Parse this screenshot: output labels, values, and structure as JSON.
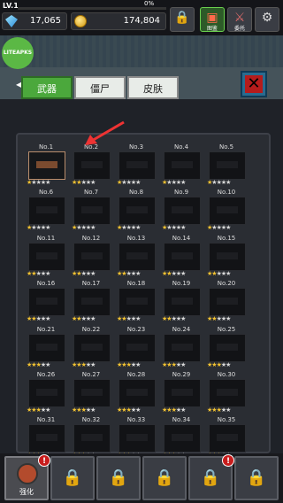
{
  "header": {
    "level": "LV.1",
    "xp_percent": "0%",
    "gems": "17,065",
    "coins": "174,804",
    "buttons": [
      {
        "name": "lock",
        "label": ""
      },
      {
        "name": "book",
        "label": "图鉴"
      },
      {
        "name": "commission",
        "label": "委托"
      },
      {
        "name": "settings",
        "label": ""
      }
    ]
  },
  "logo_text": "LITEAPKS",
  "tabs": [
    {
      "label": "武器",
      "active": true
    },
    {
      "label": "僵尸",
      "active": false
    },
    {
      "label": "皮肤",
      "active": false
    }
  ],
  "weapons": [
    {
      "label": "No.1",
      "stars": 1,
      "revealed": true,
      "selected": true
    },
    {
      "label": "No.2",
      "stars": 2
    },
    {
      "label": "No.3",
      "stars": 1
    },
    {
      "label": "No.4",
      "stars": 1
    },
    {
      "label": "No.5",
      "stars": 1
    },
    {
      "label": "No.6",
      "stars": 1
    },
    {
      "label": "No.7",
      "stars": 1
    },
    {
      "label": "No.8",
      "stars": 1
    },
    {
      "label": "No.9",
      "stars": 1
    },
    {
      "label": "No.10",
      "stars": 1
    },
    {
      "label": "No.11",
      "stars": 2
    },
    {
      "label": "No.12",
      "stars": 2
    },
    {
      "label": "No.13",
      "stars": 2
    },
    {
      "label": "No.14",
      "stars": 2
    },
    {
      "label": "No.15",
      "stars": 2
    },
    {
      "label": "No.16",
      "stars": 2
    },
    {
      "label": "No.17",
      "stars": 2
    },
    {
      "label": "No.18",
      "stars": 2
    },
    {
      "label": "No.19",
      "stars": 2
    },
    {
      "label": "No.20",
      "stars": 2
    },
    {
      "label": "No.21",
      "stars": 3
    },
    {
      "label": "No.22",
      "stars": 3
    },
    {
      "label": "No.23",
      "stars": 3
    },
    {
      "label": "No.24",
      "stars": 3
    },
    {
      "label": "No.25",
      "stars": 3
    },
    {
      "label": "No.26",
      "stars": 3
    },
    {
      "label": "No.27",
      "stars": 3
    },
    {
      "label": "No.28",
      "stars": 3
    },
    {
      "label": "No.29",
      "stars": 3
    },
    {
      "label": "No.30",
      "stars": 3
    },
    {
      "label": "No.31",
      "stars": 3
    },
    {
      "label": "No.32",
      "stars": 3
    },
    {
      "label": "No.33",
      "stars": 3
    },
    {
      "label": "No.34",
      "stars": 3
    },
    {
      "label": "No.35",
      "stars": 3
    }
  ],
  "bottom_slots": [
    {
      "label": "强化",
      "locked": false,
      "alert": true
    },
    {
      "label": "",
      "locked": true,
      "alert": false
    },
    {
      "label": "",
      "locked": true,
      "alert": false
    },
    {
      "label": "",
      "locked": true,
      "alert": false
    },
    {
      "label": "",
      "locked": true,
      "alert": true
    },
    {
      "label": "",
      "locked": true,
      "alert": false
    }
  ],
  "colors": {
    "star_on": "#f2c231",
    "star_off": "#d8d8d8",
    "tab_active": "#4ba83c",
    "alert": "#c81d1d"
  }
}
